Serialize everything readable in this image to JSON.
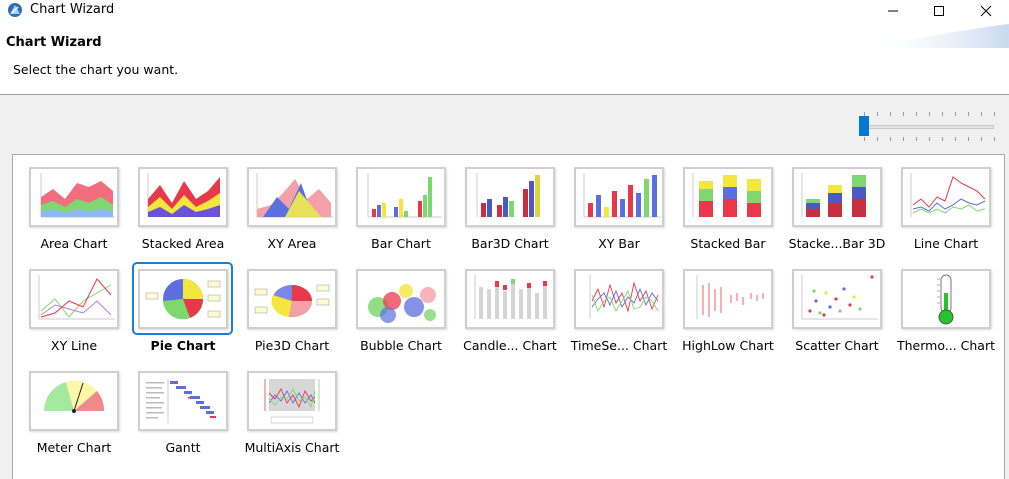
{
  "window": {
    "title": "Chart Wizard",
    "icon": "chart-wizard-app-icon",
    "buttons": [
      "minimize-icon",
      "maximize-icon",
      "close-icon"
    ]
  },
  "header": {
    "title": "Chart Wizard",
    "description": "Select the chart you want."
  },
  "zoom_slider": {
    "value_fraction": 0.0
  },
  "gallery": {
    "selected_index": 10,
    "items": [
      {
        "label": "Area Chart",
        "icon": "area-chart-icon"
      },
      {
        "label": "Stacked Area",
        "icon": "stacked-area-chart-icon"
      },
      {
        "label": "XY Area",
        "icon": "xy-area-chart-icon"
      },
      {
        "label": "Bar Chart",
        "icon": "bar-chart-icon"
      },
      {
        "label": "Bar3D Chart",
        "icon": "bar3d-chart-icon"
      },
      {
        "label": "XY Bar",
        "icon": "xy-bar-chart-icon"
      },
      {
        "label": "Stacked Bar",
        "icon": "stacked-bar-chart-icon"
      },
      {
        "label": "Stacke...Bar 3D",
        "icon": "stacked-bar-3d-chart-icon"
      },
      {
        "label": "Line Chart",
        "icon": "line-chart-icon"
      },
      {
        "label": "XY Line",
        "icon": "xy-line-chart-icon"
      },
      {
        "label": "Pie Chart",
        "icon": "pie-chart-icon"
      },
      {
        "label": "Pie3D Chart",
        "icon": "pie3d-chart-icon"
      },
      {
        "label": "Bubble Chart",
        "icon": "bubble-chart-icon"
      },
      {
        "label": "Candle... Chart",
        "icon": "candlestick-chart-icon"
      },
      {
        "label": "TimeSe... Chart",
        "icon": "time-series-chart-icon"
      },
      {
        "label": "HighLow Chart",
        "icon": "high-low-chart-icon"
      },
      {
        "label": "Scatter Chart",
        "icon": "scatter-chart-icon"
      },
      {
        "label": "Thermo... Chart",
        "icon": "thermometer-chart-icon"
      },
      {
        "label": "Meter Chart",
        "icon": "meter-chart-icon"
      },
      {
        "label": "Gantt",
        "icon": "gantt-chart-icon"
      },
      {
        "label": "MultiAxis Chart",
        "icon": "multi-axis-chart-icon"
      }
    ]
  },
  "colors": {
    "selection": "#1a7fd4",
    "slider_thumb": "#0078d7"
  }
}
